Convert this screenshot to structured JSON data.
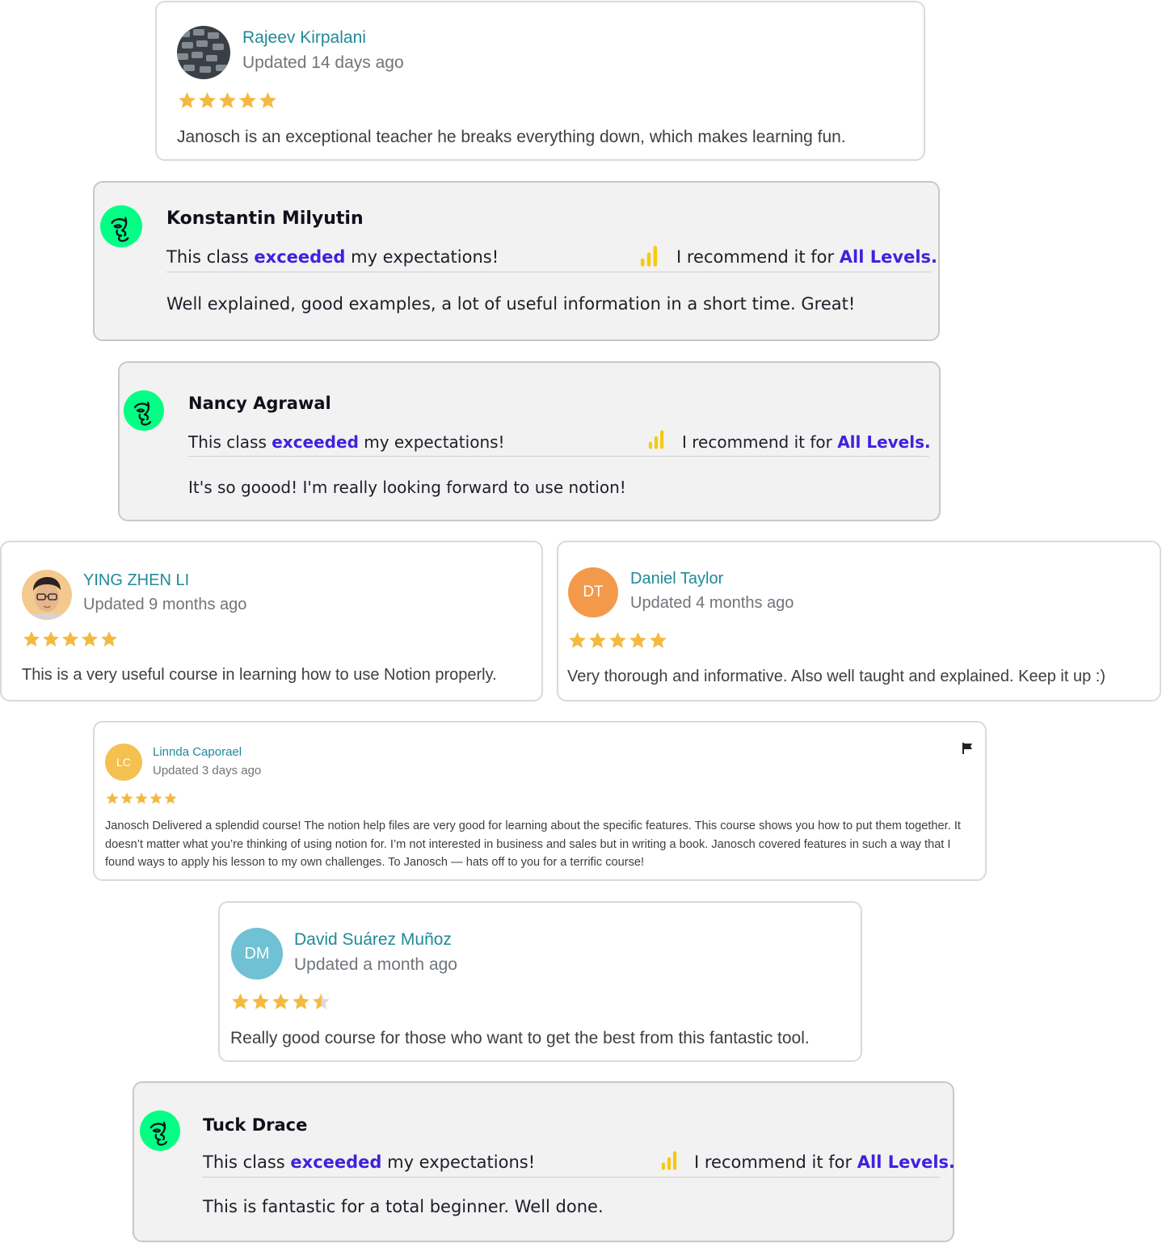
{
  "colors": {
    "google_name": "#1f8a99",
    "star": "#f4b93f",
    "skillshare_accent": "#3f22de",
    "skillshare_logo": "#00ff84",
    "level_bars": "#f6c913"
  },
  "reviews": [
    {
      "name": "Rajeev Kirpalani",
      "updated": "Updated 14 days ago",
      "rating": 5,
      "text": "Janosch is an exceptional teacher he breaks everything down, which makes learning fun.",
      "avatar": "photo"
    },
    {
      "name": "Konstantin Milyutin",
      "expect_pre": "This class ",
      "expect_word": "exceeded",
      "expect_post": " my expectations!",
      "rec_pre": "I recommend it for ",
      "rec_level": "All Levels.",
      "text": "Well explained, good examples, a lot of useful information in a short time. Great!"
    },
    {
      "name": "Nancy Agrawal",
      "expect_pre": "This class ",
      "expect_word": "exceeded",
      "expect_post": " my expectations!",
      "rec_pre": "I recommend it for ",
      "rec_level": "All Levels.",
      "text": "It's so goood! I'm really looking forward to use notion!"
    },
    {
      "name": "YING ZHEN LI",
      "updated": "Updated 9 months ago",
      "rating": 5,
      "text": "This is a very useful course in learning how to use Notion properly.",
      "avatar": "photo"
    },
    {
      "name": "Daniel Taylor",
      "updated": "Updated 4 months ago",
      "rating": 5,
      "text": "Very thorough and informative. Also well taught and explained. Keep it up :)",
      "initials": "DT",
      "avatar_color": "#f39a4a"
    },
    {
      "name": "Linnda Caporael",
      "updated": "Updated 3 days ago",
      "rating": 5,
      "text": "Janosch Delivered a splendid course! The notion help files are very good for learning about the specific features. This course shows you how to put them together. It doesn’t matter what you’re thinking of using notion for. I’m not interested in business and sales but in writing a book. Janosch covered features in such a way that I found ways to apply his lesson to my own challenges. To Janosch — hats off to you for a terrific course!",
      "initials": "LC",
      "avatar_color": "#f4c04f"
    },
    {
      "name": "David Suárez Muñoz",
      "updated": "Updated a month ago",
      "rating": 4.5,
      "text": "Really good course for those who want to get the best from this fantastic tool.",
      "initials": "DM",
      "avatar_color": "#6fc1d3"
    },
    {
      "name": "Tuck Drace",
      "expect_pre": "This class ",
      "expect_word": "exceeded",
      "expect_post": " my expectations!",
      "rec_pre": "I recommend it for ",
      "rec_level": "All Levels.",
      "text": "This is fantastic for a total beginner. Well done."
    }
  ]
}
